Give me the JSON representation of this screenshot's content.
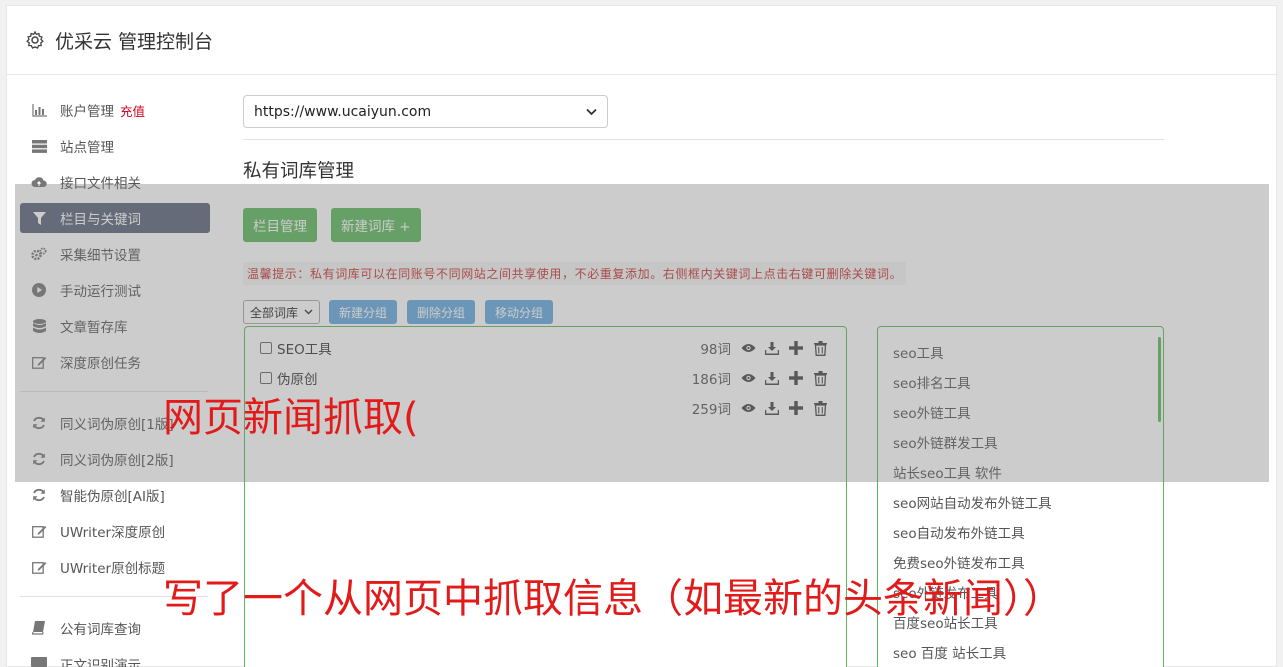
{
  "header": {
    "title": "优采云 管理控制台",
    "icon": "gear-icon"
  },
  "sidebar": {
    "group1": [
      {
        "label": "账户管理",
        "extra": "充值",
        "icon": "bar-chart-icon"
      },
      {
        "label": "站点管理",
        "icon": "server-icon"
      },
      {
        "label": "接口文件相关",
        "icon": "cloud-upload-icon"
      },
      {
        "label": "栏目与关键词",
        "icon": "filter-icon",
        "active": true
      },
      {
        "label": "采集细节设置",
        "icon": "cogs-icon"
      },
      {
        "label": "手动运行测试",
        "icon": "play-circle-icon"
      },
      {
        "label": "文章暂存库",
        "icon": "database-icon"
      },
      {
        "label": "深度原创任务",
        "icon": "edit-icon"
      }
    ],
    "group2": [
      {
        "label": "同义词伪原创[1版]",
        "icon": "refresh-icon"
      },
      {
        "label": "同义词伪原创[2版]",
        "icon": "refresh-icon"
      },
      {
        "label": "智能伪原创[AI版]",
        "icon": "refresh-icon"
      },
      {
        "label": "UWriter深度原创",
        "icon": "edit-icon"
      },
      {
        "label": "UWriter原创标题",
        "icon": "edit-icon"
      }
    ],
    "group3": [
      {
        "label": "公有词库查询",
        "icon": "book-icon"
      },
      {
        "label": "正文识别演示",
        "icon": "monitor-icon"
      }
    ]
  },
  "main": {
    "site_select": "https://www.ucaiyun.com",
    "section_title": "私有词库管理",
    "btn_columns": "栏目管理",
    "btn_new_lib": "新建词库 +",
    "tip": "温馨提示：私有词库可以在同账号不同网站之间共享使用，不必重复添加。右侧框内关键词上点击右键可删除关键词。",
    "group_select": "全部词库",
    "btn_new_group": "新建分组",
    "btn_delete_group": "删除分组",
    "btn_move_group": "移动分组",
    "libraries": [
      {
        "name": "SEO工具",
        "count": "98词"
      },
      {
        "name": "伪原创",
        "count": "186词"
      },
      {
        "name": "",
        "count": "259词"
      }
    ],
    "keywords": [
      "seo工具",
      "seo排名工具",
      "seo外链工具",
      "seo外链群发工具",
      "站长seo工具 软件",
      "seo网站自动发布外链工具",
      "seo自动发布外链工具",
      "免费seo外链发布工具",
      "seo外链发布工具",
      "百度seo站长工具",
      "seo 百度 站长工具"
    ]
  },
  "overlay": {
    "caption_1": "网页新闻抓取(",
    "caption_2": "写了一个从网页中抓取信息（如最新的头条新闻））"
  }
}
